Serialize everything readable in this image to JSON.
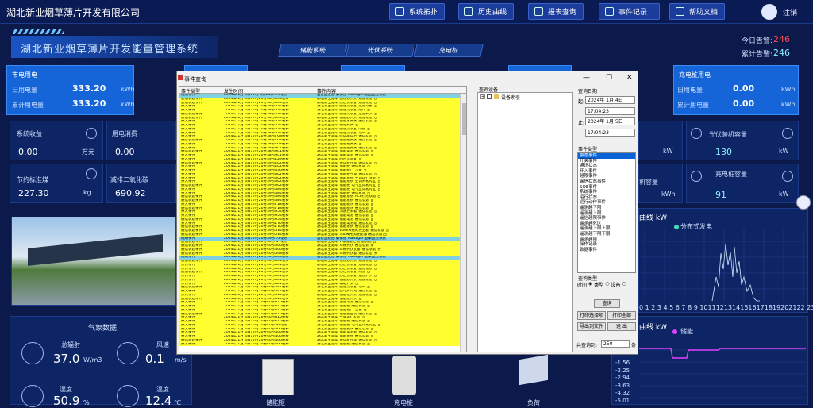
{
  "header": {
    "title": "湖北新业烟草薄片开发有限公司",
    "nav": [
      "系统拓扑",
      "历史曲线",
      "报表查询",
      "事件记录",
      "帮助文档"
    ],
    "logout": "注销"
  },
  "system_title": "湖北新业烟草薄片开发能量管理系统",
  "tabs": [
    "储能系统",
    "光伏系统",
    "充电桩"
  ],
  "alarms": {
    "today_label": "今日告警:",
    "today_value": "246",
    "total_label": "累计告警:",
    "total_value": "246"
  },
  "grid_card": {
    "title": "市电用电",
    "day_label": "日用电量",
    "day_value": "333.20",
    "day_unit": "kWh",
    "total_label": "累计用电量",
    "total_value": "333.20",
    "total_unit": "kWh"
  },
  "charger_card": {
    "title": "充电桩用电",
    "day_label": "日用电量",
    "day_value": "0.00",
    "day_unit": "kWh",
    "total_label": "累计用电量",
    "total_value": "0.00",
    "total_unit": "kWh"
  },
  "stats": {
    "income_label": "系统收益",
    "income_value": "0.00",
    "income_unit": "万元",
    "cost_label": "用电消费",
    "cost_value": "0.00",
    "coal_label": "节约标准煤",
    "coal_value": "227.30",
    "coal_unit": "kg",
    "co2_label": "减排二氧化碳",
    "co2_value": "690.92"
  },
  "right_stats": {
    "r1_unit": "kW",
    "pv_label": "光伏装机容量",
    "pv_value": "130",
    "pv_unit": "kW",
    "r2_label": "机容量",
    "r2_unit": "kWh",
    "cap_label": "充电桩容量",
    "cap_value": "91",
    "cap_unit": "kW"
  },
  "weather": {
    "title": "气象数据",
    "rad_label": "总辐射",
    "rad_value": "37.0",
    "rad_unit": "W/m3",
    "wind_label": "风速",
    "wind_value": "0.1",
    "wind_unit": "m/s",
    "hum_label": "湿度",
    "hum_value": "50.9",
    "hum_unit": "%",
    "temp_label": "温度",
    "temp_value": "12.4",
    "temp_unit": "℃"
  },
  "curve1": {
    "title_suffix": "曲线 kW",
    "legend": "分布式发电",
    "ticks": "0 1 2 3 4 5 6 7 8 9 10111213141516171819202122 23"
  },
  "curve2": {
    "title_suffix": "曲线 kW",
    "legend": "储能",
    "ticks": [
      "-1.56",
      "-2.25",
      "-2.94",
      "-3.63",
      "-4.32",
      "-5.01"
    ]
  },
  "dialog": {
    "title": "事件查询",
    "col_type": "事件类型",
    "col_time": "发生时间",
    "col_content": "事件内容",
    "tree_header": "查询设备",
    "tree_root": "设备索引",
    "date_header": "查询日期",
    "from_label": "起:",
    "from_date": "2024年 1月 4日",
    "from_time": "17:04:23",
    "to_label": "止:",
    "to_date": "2024年 1月 5日",
    "to_time": "17:04:23",
    "etype_header": "事件类型",
    "etypes": [
      "装态事件",
      "开关事件",
      "通讯状态",
      "开入事件",
      "越限事件",
      "遥信状态事件",
      "SOE事件",
      "系统事件",
      "运行状态",
      "运行动作事件",
      "遥测越下限",
      "遥测越上限",
      "遥信越限事件",
      "遥测越死区",
      "遥测越上限上限",
      "遥测越下限下限",
      "遥测越限",
      "操作记录",
      "数据事件"
    ],
    "mode_header": "查询类型",
    "mode_time": "时间",
    "mode_type": "类型",
    "mode_device": "设备",
    "btn_query": "查询",
    "btn_print_report": "打印选择项",
    "btn_print_all": "打印全部",
    "btn_export": "导出到文件",
    "btn_exit": "退 出",
    "total_label": "共查询到:",
    "total_value": "250",
    "total_unit": "条",
    "rows": [
      [
        "网络事件",
        "2024年 1月 4日17时 8分24秒473毫秒",
        "运行监控图 操作员 Manager 退出监控系统"
      ],
      [
        "通信状态事件",
        "2024年 1月 4日17时20分38秒634毫秒",
        "湖北新业烟草 光伏总开关 通信状态 合"
      ],
      [
        "通信状态事件",
        "2024年 1月 4日17时20分38秒634毫秒",
        "湖北新业烟草 防逆流装置 通信状态 合"
      ],
      [
        "开入事件",
        "2024年 1月 4日17时20分38秒634毫秒",
        "湖北新业烟草 防逆流装置 远程切换 合"
      ],
      [
        "开入事件",
        "2024年 1月 4日17时20分38秒634毫秒",
        "湖北新业烟草 防逆流装置 同口 合"
      ],
      [
        "通信状态事件",
        "2024年 1月 4日17时20分38秒634毫秒",
        "湖北新业烟草 防逆流装置 远程开入 合"
      ],
      [
        "通信状态事件",
        "2024年 1月 4日17时20分38秒634毫秒",
        "湖北新业烟草 储能总开关 通信状态 合"
      ],
      [
        "开入事件",
        "2024年 1月 4日17时20分38秒634毫秒",
        "湖北新业烟草 储能总开关 通信状态 合"
      ],
      [
        "开入事件",
        "2024年 1月 4日17时20分38秒634毫秒",
        "湖北新业烟草 辅助开关 合"
      ],
      [
        "开入事件",
        "2024年 1月 4日17时20分38秒634毫秒",
        "湖北新业烟草 防逆流装置 闭锁 合"
      ],
      [
        "开入事件",
        "2024年 1月 4日17时20分38秒634毫秒",
        "湖北新业烟草 防逆流装置 功率 合"
      ],
      [
        "开入事件",
        "2024年 1月 4日17时20分38秒768毫秒",
        "湖北新业烟草 配电屏母线 通信状态 合"
      ],
      [
        "通信状态事件",
        "2024年 1月 4日17时20分38秒768毫秒",
        "湖北新业烟草 储能柜开关 通信状态 合"
      ],
      [
        "开入事件",
        "2024年 1月 4日17时20分38秒768毫秒",
        "湖北新业烟草 储能柜开关 合"
      ],
      [
        "开入事件",
        "2024年 1月 4日17时20分38秒901毫秒",
        "湖北新业烟草 储能柜开关 通信状态 合"
      ],
      [
        "通信状态事件",
        "2024年 1月 4日17时20分38秒901毫秒",
        "湖北新业烟草 储能电池 通信状态 合"
      ],
      [
        "开入事件",
        "2024年 1月 4日17时20分38秒901毫秒",
        "湖北新业烟草 储能电池 通信状态 合"
      ],
      [
        "开入事件",
        "2024年 1月 4日17时20分39秒129毫秒",
        "湖北新业烟草 防逆流装置 合"
      ],
      [
        "通信状态事件",
        "2024年 1月 4日17时20分39秒202毫秒",
        "湖北新业烟草 充电桩用电 通信状态 合"
      ],
      [
        "开入事件",
        "2024年 1月 4日17时20分39秒202毫秒",
        "湖北新业烟草 储能柜 通信状态 合"
      ],
      [
        "开入事件",
        "2024年 1月 4日17时20分39秒336毫秒",
        "湖北新业烟草 储能柜门 告警 合"
      ],
      [
        "开入事件",
        "2024年 1月 4日17时20分39秒362毫秒",
        "湖北新业烟草 储能柜空调 通信状态 合"
      ],
      [
        "开入事件",
        "2024年 1月 4日17时20分39秒362毫秒",
        "湖北新业烟草 储能系统 空调运行状态 合"
      ],
      [
        "开入事件",
        "2024年 1月 4日17时20分39秒362毫秒",
        "湖北新业烟草 储能系统 空调开机停止 合"
      ],
      [
        "通信状态事件",
        "2024年 1月 4日17时20分39秒362毫秒",
        "湖北新业烟草 储能柜 电气室风机停止 合"
      ],
      [
        "开入事件",
        "2024年 1月 4日17时20分39秒484毫秒",
        "湖北新业烟草 储能柜 电气室风机停止 合"
      ],
      [
        "开入事件",
        "2024年 1月 4日17时20分39秒484毫秒",
        "湖北新业烟草 储能柜 通信状态 合"
      ],
      [
        "通信状态事件",
        "2024年 1月 4日17时20分39秒484毫秒",
        "湖北新业烟草 储能系统 PCS在线状态 合"
      ],
      [
        "通信状态事件",
        "2024年 1月 4日17时20分39秒484毫秒",
        "湖北新业烟草 储能系统 通信状态 合"
      ],
      [
        "开入事件",
        "2024年 1月 4日17时20分39秒718毫秒",
        "湖北新业烟草 储能模块 通信状态 合"
      ],
      [
        "通信状态事件",
        "2024年 1月 4日17时20分39秒718毫秒",
        "湖北新业烟草 储能模块 通信状态 合"
      ],
      [
        "开入事件",
        "2024年 1月 4日17时20分39秒954毫秒",
        "湖北新业烟草 消防控制器 通信状态 合"
      ],
      [
        "开入事件",
        "2024年 1月 4日17时20分39秒954毫秒",
        "湖北新业烟草 储能电池 通信状态 合"
      ],
      [
        "通信状态事件",
        "2024年 1月 4日17时20分39秒954毫秒",
        "湖北新业烟草 储能电池 通信状态 合"
      ],
      [
        "开入事件",
        "2024年 1月 4日17时20分39秒170毫秒",
        "湖北新业烟草 储能电池组 通信状态 合"
      ],
      [
        "通信状态事件",
        "2024年 1月 4日17时20分39秒170毫秒",
        "湖北新业烟草 储能系统 通信状态 合"
      ],
      [
        "通信状态事件",
        "2024年 1月 4日17时20分39秒514毫秒",
        "湖北新业烟草 100kw光伏逆变器 通信状态 合"
      ],
      [
        "通信状态事件",
        "2024年 1月 4日17时20分39秒514毫秒",
        "湖北新业烟草 30kw光伏逆变器 通信状态 合"
      ],
      [
        "网络事件",
        "2024年 1月 4日17时20分39秒 75毫秒",
        "运行监控图 操作员 Manager 登录监控系统"
      ],
      [
        "通信状态事件",
        "2024年 1月 4日17时20分40秒 57毫秒",
        "湖北新业烟草 1号储能柜 通信状态 合"
      ],
      [
        "通信状态事件",
        "2024年 1月 4日17时20分40秒406毫秒",
        "湖北新业烟草 车棚光伏 通信状态 分"
      ],
      [
        "通信状态事件",
        "2024年 1月 4日17时20分40秒406毫秒",
        "湖北新业烟草 车棚光伏变器 通信状态 分"
      ],
      [
        "通信状态事件",
        "2024年 1月 4日17时20分40秒548毫秒",
        "湖北新业烟草 车棚光伏器 通信状态 分"
      ],
      [
        "网络事件",
        "2024年 1月 4日17时20分40秒644毫秒",
        "运行监控图 操作员 Manager 登录监控系统"
      ],
      [
        "通信状态事件",
        "2024年 1月 4日17时20分40秒681毫秒",
        "湖北新业烟草 光伏总开关 通信状态 合"
      ],
      [
        "开入事件",
        "2024年 1月 4日17时20分40秒681毫秒",
        "湖北新业烟草 防逆流装置 通信状态 合"
      ],
      [
        "开入事件",
        "2024年 1月 4日17时20分40秒681毫秒",
        "湖北新业烟草 防逆流装置 远程切换 合"
      ],
      [
        "通信状态事件",
        "2024年 1月 4日17时20分40秒681毫秒",
        "湖北新业烟草 防逆流装置 闭锁 合"
      ],
      [
        "开入事件",
        "2024年 1月 4日17时20分40秒681毫秒",
        "湖北新业烟草 防逆流装置 远程开入 合"
      ],
      [
        "开入事件",
        "2024年 1月 4日17时20分40秒681毫秒",
        "湖北新业烟草 储能总开关 通信状态 合"
      ],
      [
        "开入事件",
        "2024年 1月 4日17时20分40秒681毫秒",
        "湖北新业烟草 辅助开关 合"
      ],
      [
        "通信状态事件",
        "2024年 1月 4日17时20分40秒681毫秒",
        "湖北新业烟草 防逆流装置 功率 合"
      ],
      [
        "开入事件",
        "2024年 1月 4日17时20分40秒681毫秒",
        "湖北新业烟草 配电屏母线 通信状态 合"
      ],
      [
        "开入事件",
        "2024年 1月 4日17时20分40秒815毫秒",
        "湖北新业烟草 储能柜开关 通信状态 合"
      ],
      [
        "通信状态事件",
        "2024年 1月 4日17时20分40秒815毫秒",
        "湖北新业烟草 储能柜开关 合"
      ],
      [
        "开入事件",
        "2024年 1月 4日17时20分40秒815毫秒",
        "湖北新业烟草 储能电池 通信状态 合"
      ],
      [
        "开入事件",
        "2024年 1月 4日17时20分40秒815毫秒",
        "湖北新业烟草 储能柜 通信状态 合"
      ],
      [
        "开入事件",
        "2024年 1月 4日17时20分40秒815毫秒",
        "湖北新业烟草 储能柜门 告警 合"
      ],
      [
        "通信状态事件",
        "2024年 1月 4日17时20分40秒815毫秒",
        "湖北新业烟草 储能柜空调 通信状态 合"
      ],
      [
        "开入事件",
        "2024年 1月 4日17时20分40秒815毫秒",
        "湖北新业烟草 空调运行状态 合"
      ],
      [
        "开入事件",
        "2024年 1月 4日17时20分40秒815毫秒",
        "湖北新业烟草 储能柜 通信状态 合"
      ],
      [
        "开入事件",
        "2024年 1月 4日17时20分40秒 95毫秒",
        "湖北新业烟草 储能柜 电气室风机停止 合"
      ],
      [
        "开入事件",
        "2024年 1月 4日17时20分40秒406毫秒",
        "湖北新业烟草 储能模块 通信状态 合"
      ],
      [
        "开入事件",
        "2024年 1月 4日17时20分40秒406毫秒",
        "湖北新业烟草 储能电池组 通信状态 合"
      ],
      [
        "开入事件",
        "2024年 1月 4日17时20分40秒406毫秒",
        "湖北新业烟草 储能系统 通信状态 合"
      ],
      [
        "通信状态事件",
        "2024年 1月 4日17时20分40秒406毫秒",
        "湖北新业烟草 充电桩用电 通信状态 合"
      ],
      [
        "开入事件",
        "2024年 1月 4日17时20分40秒406毫秒",
        "湖北新业烟草 储能柜 通信状态 合"
      ]
    ]
  },
  "equipment": {
    "item1": "储能柜",
    "item2": "充电桩",
    "item3": "负荷"
  }
}
